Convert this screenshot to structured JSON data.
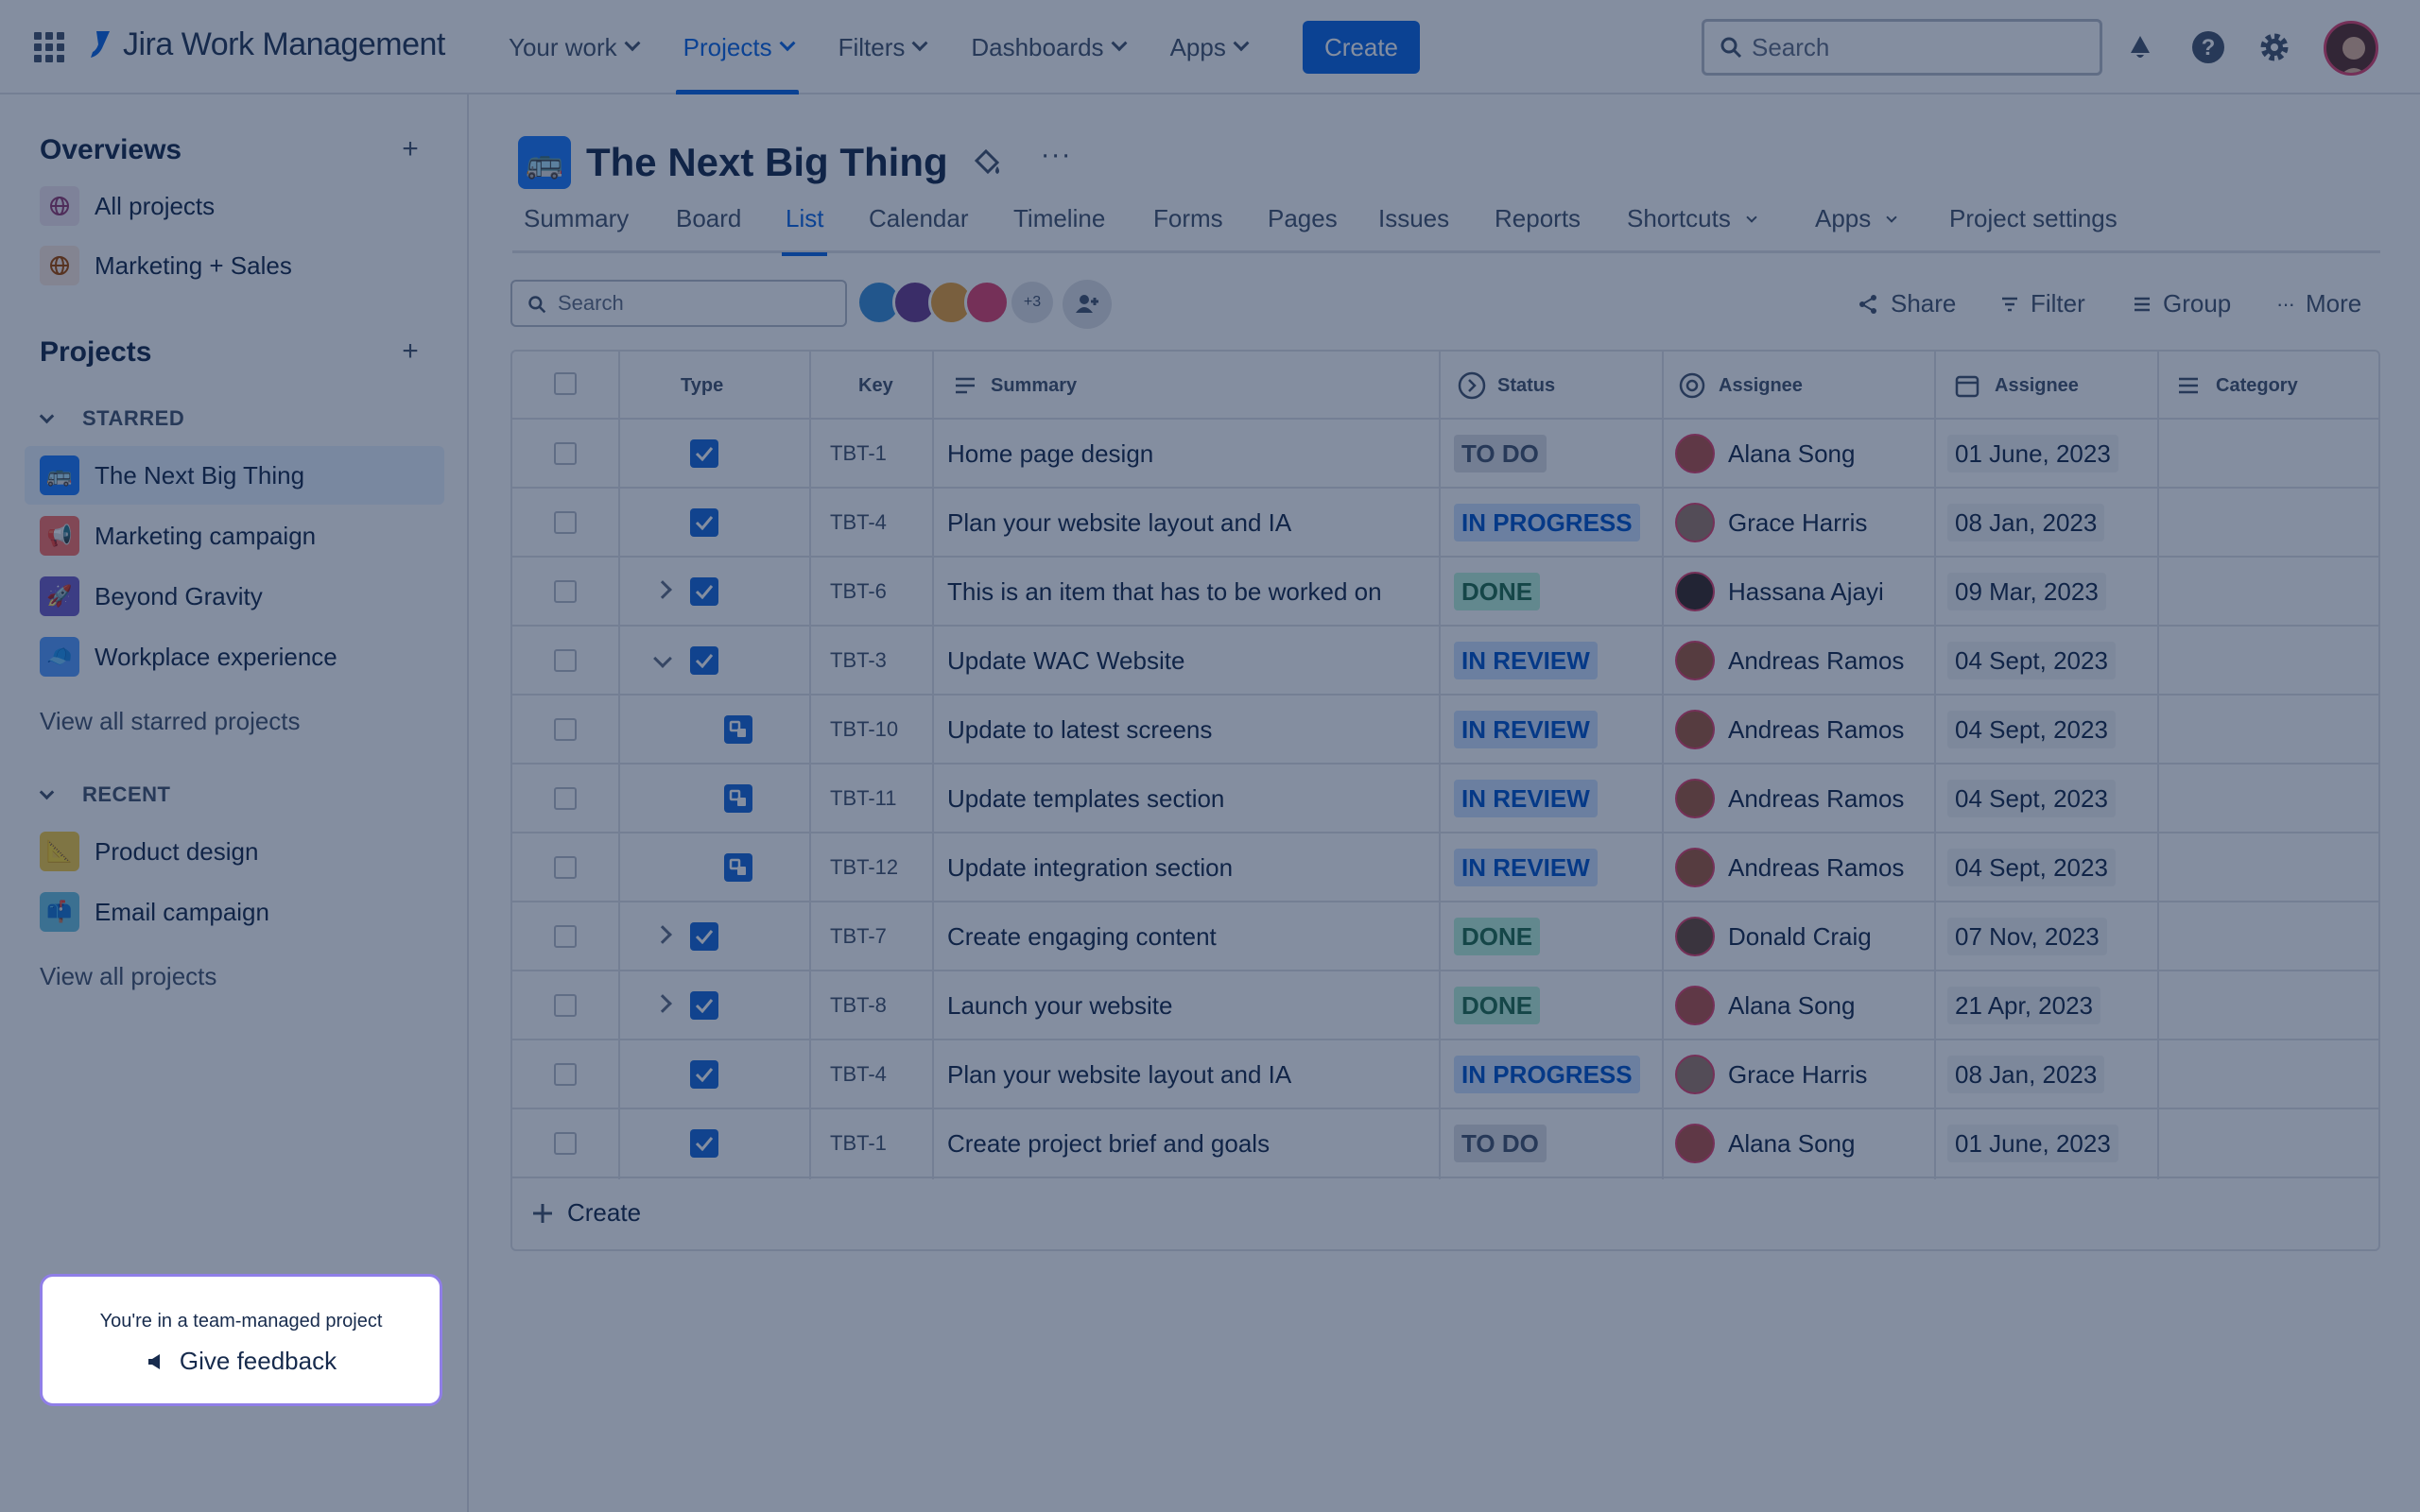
{
  "topnav": {
    "product": "Jira Work Management",
    "items": [
      {
        "label": "Your work"
      },
      {
        "label": "Projects"
      },
      {
        "label": "Filters"
      },
      {
        "label": "Dashboards"
      },
      {
        "label": "Apps"
      }
    ],
    "active_item": "Projects",
    "create_label": "Create",
    "search_placeholder": "Search"
  },
  "sidebar": {
    "overviews_heading": "Overviews",
    "overviews": [
      {
        "label": "All projects"
      },
      {
        "label": "Marketing + Sales"
      }
    ],
    "projects_heading": "Projects",
    "starred_heading": "STARRED",
    "starred": [
      {
        "label": "The Next Big Thing",
        "selected": true
      },
      {
        "label": "Marketing campaign"
      },
      {
        "label": "Beyond Gravity"
      },
      {
        "label": "Workplace experience"
      }
    ],
    "view_all_starred": "View all starred projects",
    "recent_heading": "RECENT",
    "recent": [
      {
        "label": "Product design"
      },
      {
        "label": "Email campaign"
      }
    ],
    "view_all_projects": "View all projects",
    "feedback": {
      "text": "You're in a team-managed project",
      "button": "Give feedback"
    }
  },
  "project": {
    "title": "The Next Big Thing",
    "tabs": [
      {
        "label": "Summary"
      },
      {
        "label": "Board"
      },
      {
        "label": "List"
      },
      {
        "label": "Calendar"
      },
      {
        "label": "Timeline"
      },
      {
        "label": "Forms"
      },
      {
        "label": "Pages"
      },
      {
        "label": "Issues"
      },
      {
        "label": "Reports"
      },
      {
        "label": "Shortcuts"
      },
      {
        "label": "Apps"
      },
      {
        "label": "Project settings"
      }
    ],
    "active_tab": "List"
  },
  "toolbar": {
    "search_placeholder": "Search",
    "avatars_more": "+3",
    "share": "Share",
    "filter": "Filter",
    "group": "Group",
    "more": "More"
  },
  "table": {
    "headers": {
      "type": "Type",
      "key": "Key",
      "summary": "Summary",
      "status": "Status",
      "assignee": "Assignee",
      "date": "Assignee",
      "category": "Category"
    },
    "rows": [
      {
        "type": "task",
        "expander": "",
        "key": "TBT-1",
        "summary": "Home page design",
        "status": "TO DO",
        "status_kind": "todo",
        "assignee": "Alana Song",
        "date": "01 June, 2023",
        "avatar_color": "#b4524a"
      },
      {
        "type": "task",
        "expander": "",
        "key": "TBT-4",
        "summary": "Plan your website layout and IA",
        "status": "IN PROGRESS",
        "status_kind": "prog",
        "assignee": "Grace Harris",
        "date": "08 Jan, 2023",
        "avatar_color": "#9c7b6c"
      },
      {
        "type": "task",
        "expander": "collapsed",
        "key": "TBT-6",
        "summary": "This is an item that has to be worked on",
        "status": "DONE",
        "status_kind": "done",
        "assignee": "Hassana Ajayi",
        "date": "09 Mar, 2023",
        "avatar_color": "#3b2a26"
      },
      {
        "type": "task",
        "expander": "expanded",
        "key": "TBT-3",
        "summary": "Update WAC Website",
        "status": "IN REVIEW",
        "status_kind": "rev",
        "assignee": "Andreas Ramos",
        "date": "04 Sept, 2023",
        "avatar_color": "#a25a3e"
      },
      {
        "type": "subtask",
        "expander": "",
        "key": "TBT-10",
        "summary": "Update to latest screens",
        "status": "IN REVIEW",
        "status_kind": "rev",
        "assignee": "Andreas Ramos",
        "date": "04 Sept, 2023",
        "avatar_color": "#a25a3e"
      },
      {
        "type": "subtask",
        "expander": "",
        "key": "TBT-11",
        "summary": "Update templates section",
        "status": "IN REVIEW",
        "status_kind": "rev",
        "assignee": "Andreas Ramos",
        "date": "04 Sept, 2023",
        "avatar_color": "#a25a3e"
      },
      {
        "type": "subtask",
        "expander": "",
        "key": "TBT-12",
        "summary": "Update integration section",
        "status": "IN REVIEW",
        "status_kind": "rev",
        "assignee": "Andreas Ramos",
        "date": "04 Sept, 2023",
        "avatar_color": "#a25a3e"
      },
      {
        "type": "task",
        "expander": "collapsed",
        "key": "TBT-7",
        "summary": "Create engaging content",
        "status": "DONE",
        "status_kind": "done",
        "assignee": "Donald Craig",
        "date": "07 Nov, 2023",
        "avatar_color": "#6b4a3a"
      },
      {
        "type": "task",
        "expander": "collapsed",
        "key": "TBT-8",
        "summary": "Launch your website",
        "status": "DONE",
        "status_kind": "done",
        "assignee": "Alana Song",
        "date": "21 Apr, 2023",
        "avatar_color": "#b4524a"
      },
      {
        "type": "task",
        "expander": "",
        "key": "TBT-4",
        "summary": "Plan your website layout and IA",
        "status": "IN PROGRESS",
        "status_kind": "prog",
        "assignee": "Grace Harris",
        "date": "08 Jan, 2023",
        "avatar_color": "#9c7b6c"
      },
      {
        "type": "task",
        "expander": "",
        "key": "TBT-1",
        "summary": "Create project brief and goals",
        "status": "TO DO",
        "status_kind": "todo",
        "assignee": "Alana Song",
        "date": "01 June, 2023",
        "avatar_color": "#b4524a"
      }
    ],
    "create_label": "Create"
  },
  "colors": {
    "accent": "#0c66e4",
    "overlay": "rgba(9,30,66,0.5)",
    "feedback_border": "#8f7ee7"
  }
}
